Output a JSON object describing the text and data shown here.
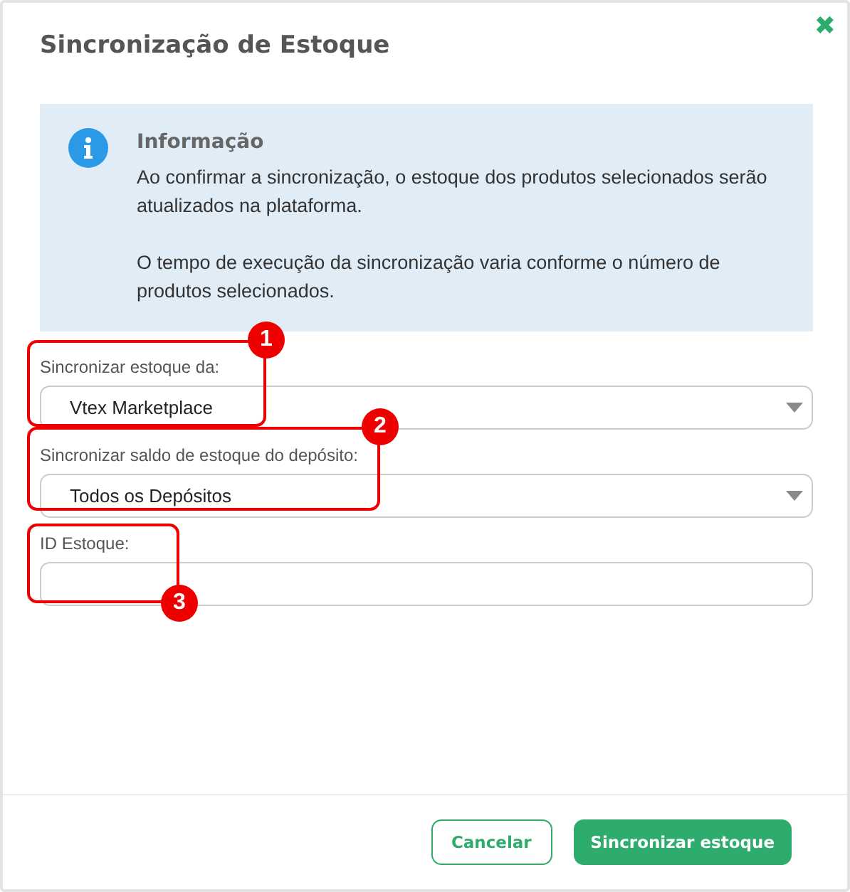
{
  "dialog": {
    "title": "Sincronização de Estoque",
    "close": "✖"
  },
  "info": {
    "heading": "Informação",
    "paragraphs": [
      "Ao confirmar a sincronização, o estoque dos produtos selecionados serão atualizados na plataforma.",
      "O tempo de execução da sincronização varia conforme o número de produtos selecionados."
    ]
  },
  "fields": [
    {
      "kind": "select",
      "label": "Sincronizar estoque da:",
      "value": "Vtex Marketplace",
      "callout": "1"
    },
    {
      "kind": "select",
      "label": "Sincronizar saldo de estoque do depósito:",
      "value": "Todos os Depósitos",
      "callout": "2"
    },
    {
      "kind": "input",
      "label": "ID Estoque:",
      "callout": "3"
    }
  ],
  "buttons": [
    {
      "label": "Cancelar",
      "kind": "secondary"
    },
    {
      "label": "Sincronizar estoque",
      "kind": "primary"
    }
  ]
}
